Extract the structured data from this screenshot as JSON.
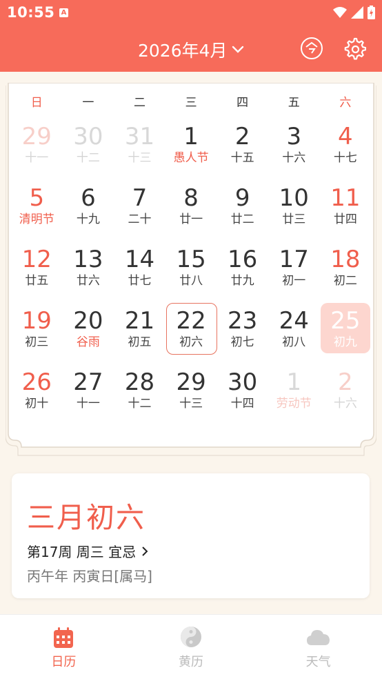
{
  "status_bar": {
    "time": "10:55",
    "notification_badge": "A"
  },
  "header": {
    "month_title": "2026年4月",
    "today_label": "今"
  },
  "weekdays": [
    "日",
    "一",
    "二",
    "三",
    "四",
    "五",
    "六"
  ],
  "calendar": {
    "weeks": [
      [
        {
          "day": "29",
          "lunar": "十一",
          "other": true,
          "weekend": true
        },
        {
          "day": "30",
          "lunar": "十二",
          "other": true
        },
        {
          "day": "31",
          "lunar": "十三",
          "other": true
        },
        {
          "day": "1",
          "lunar": "愚人节",
          "holiday": true
        },
        {
          "day": "2",
          "lunar": "十五"
        },
        {
          "day": "3",
          "lunar": "十六"
        },
        {
          "day": "4",
          "lunar": "十七",
          "weekend": true
        }
      ],
      [
        {
          "day": "5",
          "lunar": "清明节",
          "weekend": true,
          "holiday": true
        },
        {
          "day": "6",
          "lunar": "十九"
        },
        {
          "day": "7",
          "lunar": "二十"
        },
        {
          "day": "8",
          "lunar": "廿一"
        },
        {
          "day": "9",
          "lunar": "廿二"
        },
        {
          "day": "10",
          "lunar": "廿三"
        },
        {
          "day": "11",
          "lunar": "廿四",
          "weekend": true
        }
      ],
      [
        {
          "day": "12",
          "lunar": "廿五",
          "weekend": true
        },
        {
          "day": "13",
          "lunar": "廿六"
        },
        {
          "day": "14",
          "lunar": "廿七"
        },
        {
          "day": "15",
          "lunar": "廿八"
        },
        {
          "day": "16",
          "lunar": "廿九"
        },
        {
          "day": "17",
          "lunar": "初一"
        },
        {
          "day": "18",
          "lunar": "初二",
          "weekend": true
        }
      ],
      [
        {
          "day": "19",
          "lunar": "初三",
          "weekend": true
        },
        {
          "day": "20",
          "lunar": "谷雨",
          "solar_term": true
        },
        {
          "day": "21",
          "lunar": "初五"
        },
        {
          "day": "22",
          "lunar": "初六",
          "today": true
        },
        {
          "day": "23",
          "lunar": "初七"
        },
        {
          "day": "24",
          "lunar": "初八"
        },
        {
          "day": "25",
          "lunar": "初九",
          "weekend": true,
          "selected": true
        }
      ],
      [
        {
          "day": "26",
          "lunar": "初十",
          "weekend": true
        },
        {
          "day": "27",
          "lunar": "十一"
        },
        {
          "day": "28",
          "lunar": "十二"
        },
        {
          "day": "29",
          "lunar": "十三"
        },
        {
          "day": "30",
          "lunar": "十四"
        },
        {
          "day": "1",
          "lunar": "劳动节",
          "other": true,
          "holiday": true
        },
        {
          "day": "2",
          "lunar": "十六",
          "other": true,
          "weekend": true
        }
      ]
    ]
  },
  "info": {
    "lunar_date": "三月初六",
    "week_line": "第17周 周三 宜忌",
    "ganzhi": "丙午年 丙寅日[属马]"
  },
  "tabs": [
    {
      "label": "日历",
      "icon": "calendar-icon",
      "active": true
    },
    {
      "label": "黄历",
      "icon": "yin-yang-icon",
      "active": false
    },
    {
      "label": "天气",
      "icon": "cloud-icon",
      "active": false
    }
  ],
  "colors": {
    "accent": "#f76b5a",
    "holiday_red": "#f05e4c",
    "background": "#fbf5ec"
  }
}
